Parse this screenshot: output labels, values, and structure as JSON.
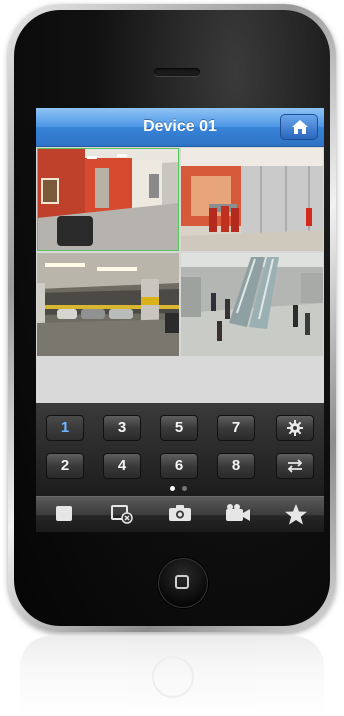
{
  "navbar": {
    "title": "Device 01",
    "home_icon": "home-icon"
  },
  "cameras": [
    {
      "id": "cam-1",
      "scene": "hallway-red-wall",
      "selected": true
    },
    {
      "id": "cam-2",
      "scene": "office-glass-room",
      "selected": false
    },
    {
      "id": "cam-3",
      "scene": "parking-garage",
      "selected": false
    },
    {
      "id": "cam-4",
      "scene": "escalator-lobby",
      "selected": false
    }
  ],
  "keypad": {
    "row1": [
      "1",
      "3",
      "5",
      "7"
    ],
    "row2": [
      "2",
      "4",
      "6",
      "8"
    ],
    "active_key": "1",
    "settings_icon": "gear-icon",
    "swap_icon": "swap-arrows-icon",
    "page_indicator": {
      "pages": 2,
      "current": 1
    }
  },
  "toolbar": {
    "icons": [
      "stop-icon",
      "close-view-icon",
      "snapshot-camera-icon",
      "record-video-icon",
      "favorite-star-icon"
    ]
  },
  "colors": {
    "nav_blue": "#3783d8",
    "active_key_text": "#6fb5ff",
    "selected_border": "#59c45a"
  }
}
